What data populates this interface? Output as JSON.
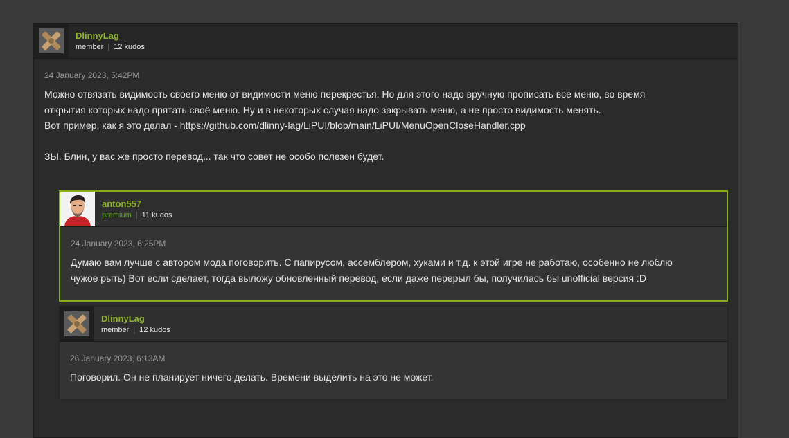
{
  "main_comment": {
    "username": "DlinnyLag",
    "role": "member",
    "kudos": "12 kudos",
    "date": "24 January 2023, 5:42PM",
    "text": "Можно отвязать видимость своего меню от видимости меню перекрестья. Но для этого надо вручную прописать все меню, во время\nоткрытия которых надо прятать своё меню. Ну и в некоторых случая надо закрывать меню, а не просто видимость менять.\nВот пример, как я это делал - https://github.com/dlinny-lag/LiPUI/blob/main/LiPUI/MenuOpenCloseHandler.cpp\n\nЗЫ. Блин, у вас же просто перевод... так что совет не особо полезен будет."
  },
  "replies": [
    {
      "username": "anton557",
      "role": "premium",
      "kudos": "11 kudos",
      "date": "24 January 2023, 6:25PM",
      "text": "Думаю вам лучше с автором мода поговорить. С папирусом, ассемблером, хуками и т.д. к этой игре не работаю, особенно не люблю\nчужое рыть) Вот если сделает, тогда выложу обновленный перевод, если даже перерыл бы, получилась бы unofficial версия :D"
    },
    {
      "username": "DlinnyLag",
      "role": "member",
      "kudos": "12 kudos",
      "date": "26 January 2023, 6:13AM",
      "text": "Поговорил. Он не планирует ничего делать. Времени выделить на это не может."
    }
  ],
  "colors": {
    "username": "#8fb32c",
    "premium_border": "#86ad1d",
    "premium_label": "#59a51a"
  }
}
